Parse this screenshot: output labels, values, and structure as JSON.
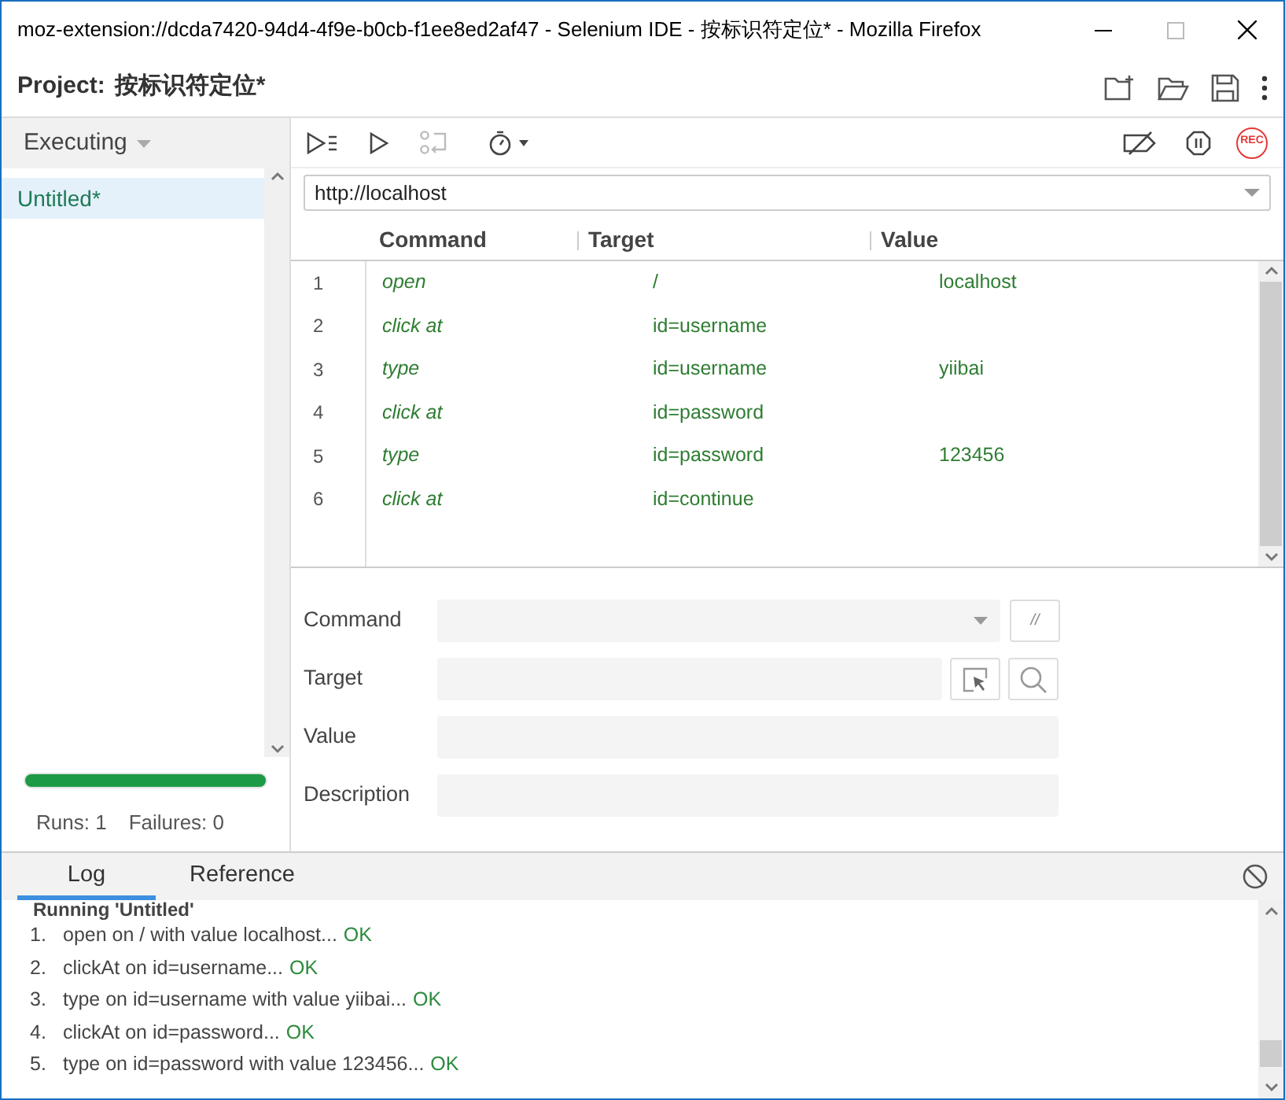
{
  "window": {
    "title": "moz-extension://dcda7420-94d4-4f9e-b0cb-f1ee8ed2af47 - Selenium IDE - 按标识符定位* - Mozilla Firefox"
  },
  "project": {
    "label": "Project:",
    "name": "按标识符定位*"
  },
  "sidebar": {
    "header": "Executing",
    "tests": [
      {
        "name": "Untitled*",
        "selected": true
      }
    ],
    "progress": {
      "level": 1.0
    },
    "runs": "Runs: 1",
    "failures": "Failures: 0"
  },
  "toolbar": {
    "record_button": "REC"
  },
  "url": "http://localhost",
  "table": {
    "columns": [
      "Command",
      "Target",
      "Value"
    ],
    "rows": [
      {
        "number": "1",
        "command": "open",
        "target": "/",
        "value": "localhost"
      },
      {
        "number": "2",
        "command": "click at",
        "target": "id=username"
      },
      {
        "number": "3",
        "command": "type",
        "target": "id=username",
        "value": "yiibai"
      },
      {
        "number": "4",
        "command": "click at",
        "target": "id=password"
      },
      {
        "number": "5",
        "command": "type",
        "target": "id=password",
        "value": "123456"
      },
      {
        "number": "6",
        "command": "click at",
        "target": "id=continue"
      }
    ]
  },
  "editor": {
    "fields": [
      {
        "label": "Command",
        "kind": "select"
      },
      {
        "label": "Target",
        "kind": "target"
      },
      {
        "label": "Value",
        "kind": "text"
      },
      {
        "label": "Description",
        "kind": "text"
      }
    ],
    "comment_button": "//"
  },
  "bottom_tabs": [
    {
      "label": "Log",
      "selected": true
    },
    {
      "label": "Reference",
      "selected": false
    }
  ],
  "log": {
    "heading": "Running 'Untitled'",
    "entries": [
      {
        "number": "1.",
        "text": "open on / with value localhost...",
        "status": "OK"
      },
      {
        "number": "2.",
        "text": "clickAt on id=username...",
        "status": "OK"
      },
      {
        "number": "3.",
        "text": "type on id=username with value yiibai...",
        "status": "OK"
      },
      {
        "number": "4.",
        "text": "clickAt on id=password...",
        "status": "OK"
      },
      {
        "number": "5.",
        "text": "type on id=password with value 123456...",
        "status": "OK"
      }
    ]
  }
}
